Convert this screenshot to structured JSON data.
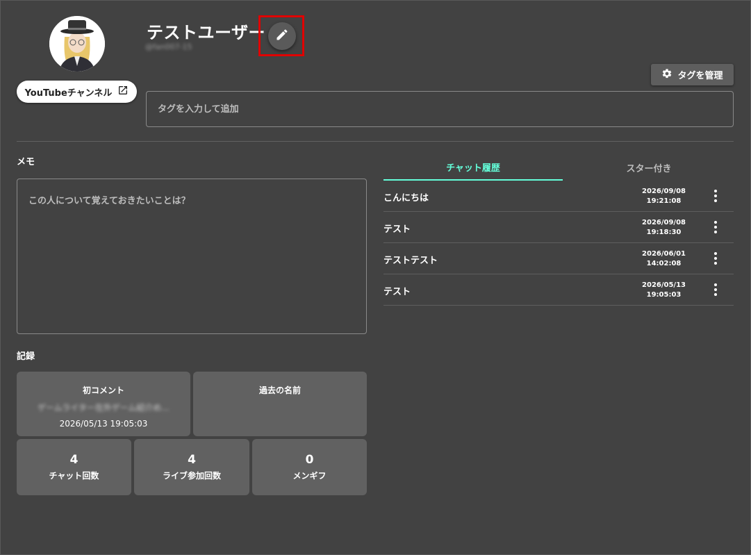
{
  "profile": {
    "username": "テストユーザー",
    "handle": "@fan007-15",
    "youtube_label": "YouTubeチャンネル"
  },
  "tags": {
    "manage_label": "タグを管理",
    "input_placeholder": "タグを入力して追加"
  },
  "memo": {
    "label": "メモ",
    "placeholder": "この人について覚えておきたいことは？"
  },
  "record": {
    "label": "記録",
    "first_comment": {
      "title": "初コメント",
      "text": "ゲームライター在外ゲーム紹介め...",
      "date": "2026/05/13 19:05:03"
    },
    "past_names": {
      "title": "過去の名前"
    },
    "stats": [
      {
        "value": "4",
        "label": "チャット回数"
      },
      {
        "value": "4",
        "label": "ライブ参加回数"
      },
      {
        "value": "0",
        "label": "メンギフ"
      }
    ]
  },
  "tabs": [
    {
      "label": "チャット履歴",
      "active": true
    },
    {
      "label": "スター付き",
      "active": false
    }
  ],
  "chat_history": [
    {
      "message": "こんにちは",
      "date": "2026/09/08",
      "time": "19:21:08"
    },
    {
      "message": "テスト",
      "date": "2026/09/08",
      "time": "19:18:30"
    },
    {
      "message": "テストテスト",
      "date": "2026/06/01",
      "time": "14:02:08"
    },
    {
      "message": "テスト",
      "date": "2026/05/13",
      "time": "19:05:03"
    }
  ],
  "colors": {
    "background": "#424242",
    "accent": "#64ffda",
    "card": "#616161",
    "highlight": "#e00000"
  },
  "icons": [
    "avatar",
    "external-link-icon",
    "pencil-icon",
    "gear-icon",
    "more-vert-icon"
  ]
}
